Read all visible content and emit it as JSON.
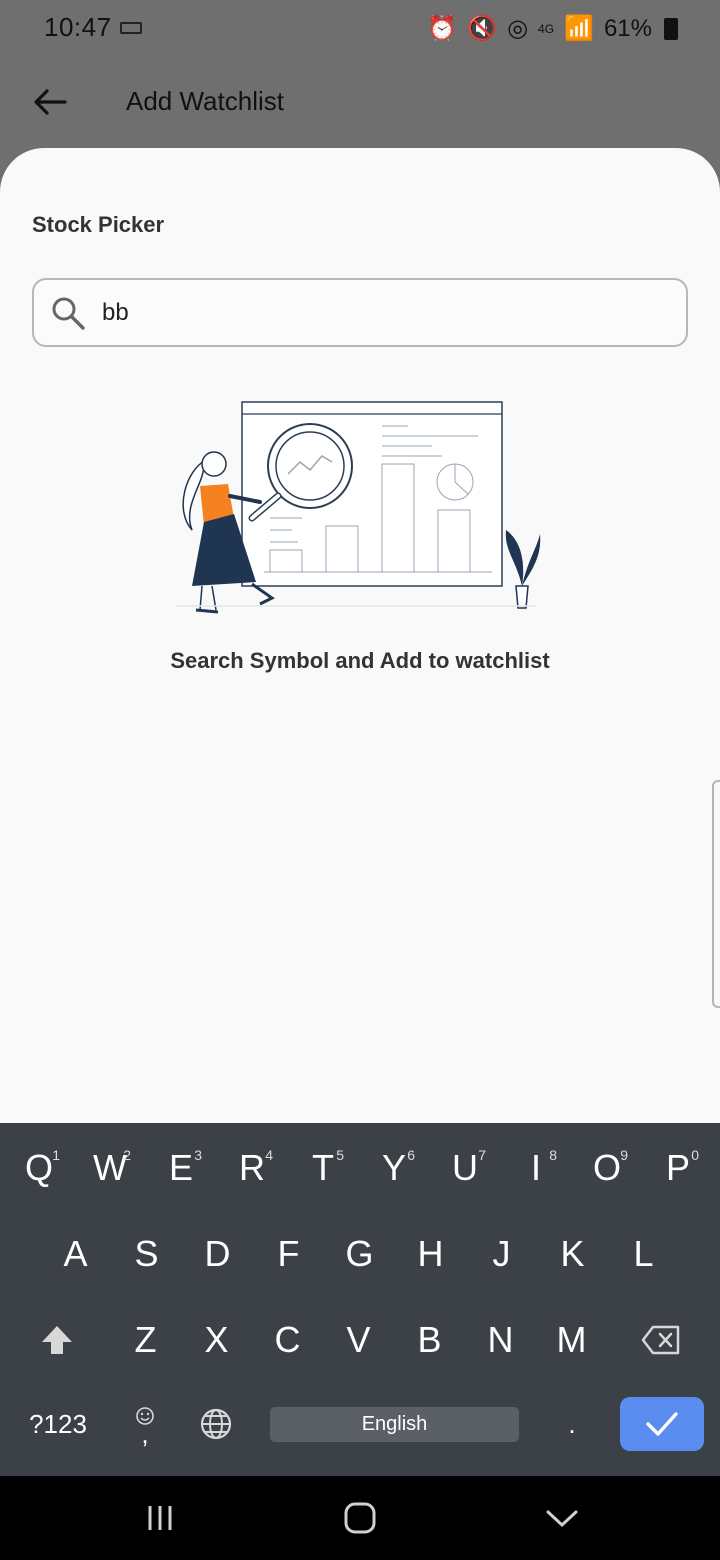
{
  "status_bar": {
    "time": "10:47",
    "battery": "61%",
    "network": "4G"
  },
  "app_bar": {
    "title": "Add Watchlist"
  },
  "sheet": {
    "title": "Stock Picker",
    "search": {
      "value": "bb"
    },
    "empty_message": "Search Symbol and Add to watchlist"
  },
  "keyboard": {
    "row1": [
      {
        "letter": "Q",
        "hint": "1"
      },
      {
        "letter": "W",
        "hint": "2"
      },
      {
        "letter": "E",
        "hint": "3"
      },
      {
        "letter": "R",
        "hint": "4"
      },
      {
        "letter": "T",
        "hint": "5"
      },
      {
        "letter": "Y",
        "hint": "6"
      },
      {
        "letter": "U",
        "hint": "7"
      },
      {
        "letter": "I",
        "hint": "8"
      },
      {
        "letter": "O",
        "hint": "9"
      },
      {
        "letter": "P",
        "hint": "0"
      }
    ],
    "row2": [
      "A",
      "S",
      "D",
      "F",
      "G",
      "H",
      "J",
      "K",
      "L"
    ],
    "row3": [
      "Z",
      "X",
      "C",
      "V",
      "B",
      "N",
      "M"
    ],
    "symbols_label": "?123",
    "emoji_punct": ",",
    "space_label": "English",
    "period": "."
  },
  "colors": {
    "accent": "#5b8df0",
    "keyboard_bg": "#3c4047",
    "sheet_bg": "#f9f9f9",
    "illustration_orange": "#f58220",
    "illustration_navy": "#1f3552"
  },
  "icons": {
    "back": "arrow-left-icon",
    "search": "magnifier-icon",
    "shift": "shift-icon",
    "backspace": "backspace-icon",
    "globe": "globe-icon",
    "enter": "check-icon"
  }
}
